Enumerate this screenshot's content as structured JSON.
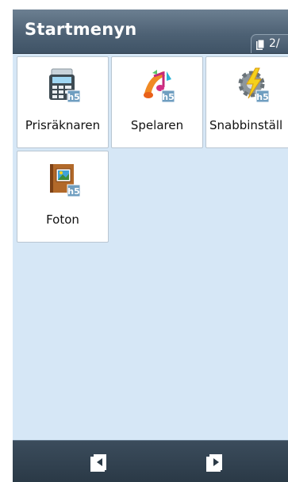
{
  "header": {
    "title": "Startmenyn",
    "page_indicator": "2/"
  },
  "apps": [
    {
      "label": "Prisräknaren",
      "icon": "calculator-icon"
    },
    {
      "label": "Spelaren",
      "icon": "music-player-icon"
    },
    {
      "label": "Snabbinställ",
      "icon": "gear-lightning-icon"
    },
    {
      "label": "Foton",
      "icon": "photo-album-icon"
    }
  ],
  "icon_badge": "h5",
  "bottom_nav": {
    "prev_icon": "previous-page-icon",
    "next_icon": "next-page-icon"
  },
  "colors": {
    "title_bar": "#4e6275",
    "content_background": "#d6e7f6",
    "tile_background": "#ffffff",
    "bottom_bar": "#2a3946"
  }
}
